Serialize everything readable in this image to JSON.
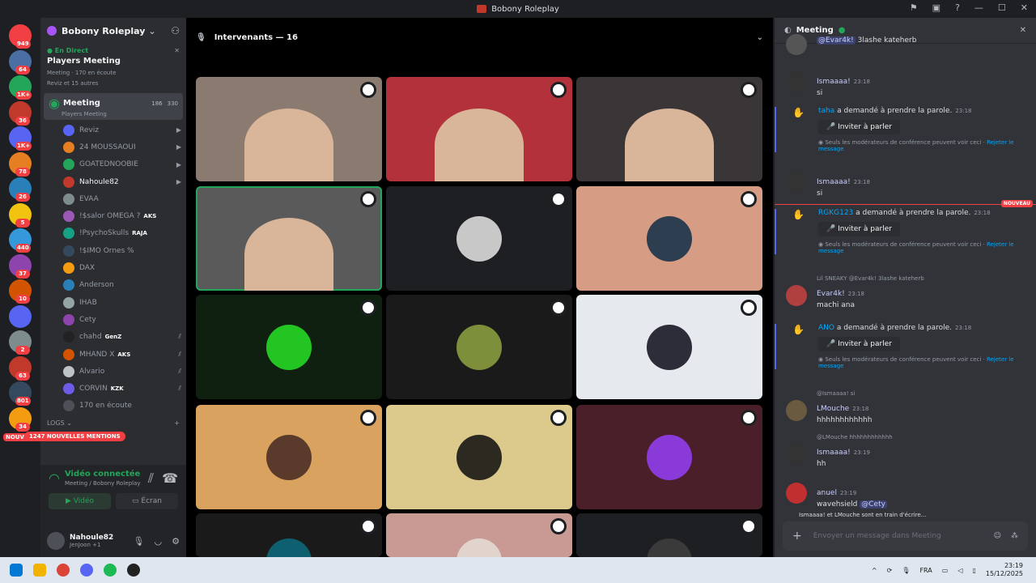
{
  "window": {
    "title": "Bobony Roleplay"
  },
  "servers": [
    {
      "badge": "949",
      "color": "#f23f43"
    },
    {
      "badge": "64",
      "color": "#4a6fa5"
    },
    {
      "badge": "1K+",
      "color": "#23a55a"
    },
    {
      "badge": "36",
      "color": "#c0392b"
    },
    {
      "badge": "1K+",
      "color": "#5865f2"
    },
    {
      "badge": "78",
      "color": "#e67e22"
    },
    {
      "badge": "26",
      "color": "#2980b9"
    },
    {
      "badge": "5",
      "color": "#f1c40f"
    },
    {
      "badge": "440",
      "color": "#3498db"
    },
    {
      "badge": "37",
      "color": "#8e44ad"
    },
    {
      "badge": "10",
      "color": "#d35400"
    },
    {
      "badge": "",
      "color": "#5865f2"
    },
    {
      "badge": "2",
      "color": "#7f8c8d"
    },
    {
      "badge": "63",
      "color": "#c0392b"
    },
    {
      "badge": "801",
      "color": "#34495e"
    },
    {
      "badge": "34",
      "color": "#f39c12"
    }
  ],
  "sidebar": {
    "guild_name": "Bobony Roleplay",
    "live_tag": "En Direct",
    "live_title": "Players Meeting",
    "live_sub": "Meeting · 170 en écoute",
    "live_sub2": "Reviz et 15 autres",
    "active_channel": {
      "name": "Meeting",
      "sub": "Players Meeting",
      "video_count": "186",
      "listeners": "330"
    },
    "members": [
      {
        "name": "Reviz",
        "tag": "",
        "icon": "camera-icon"
      },
      {
        "name": "24 MOUSSAOUI",
        "tag": "",
        "icon": "camera-icon"
      },
      {
        "name": "GOATEDNOOBIE",
        "tag": "",
        "icon": "camera-icon"
      },
      {
        "name": "Nahoule82",
        "tag": "",
        "icon": "camera-icon"
      },
      {
        "name": "EVAA",
        "tag": "",
        "icon": ""
      },
      {
        "name": "!$salor OMEGA ?",
        "tag": "AKS",
        "icon": ""
      },
      {
        "name": "!PsychoSkulls",
        "tag": "RAJA",
        "icon": ""
      },
      {
        "name": "!$IMO Ornes %",
        "tag": "",
        "icon": ""
      },
      {
        "name": "DAX",
        "tag": "",
        "icon": ""
      },
      {
        "name": "Anderson",
        "tag": "",
        "icon": ""
      },
      {
        "name": "IHAB",
        "tag": "",
        "icon": ""
      },
      {
        "name": "Cety",
        "tag": "",
        "icon": ""
      },
      {
        "name": "chahd",
        "tag": "GenZ",
        "icon": "muted-mic-icon"
      },
      {
        "name": "MHAND X",
        "tag": "AKS",
        "icon": "muted-mic-icon"
      },
      {
        "name": "Alvario",
        "tag": "",
        "icon": "muted-mic-icon"
      },
      {
        "name": "CORVIN",
        "tag": "KZK",
        "icon": "muted-mic-icon"
      },
      {
        "name": "170 en écoute",
        "tag": "",
        "icon": ""
      }
    ],
    "logs_label": "LOGS",
    "new_mentions": "1247 NOUVELLES MENTIONS",
    "nouveau": "NOUVEAU",
    "voice": {
      "status": "Vidéo connectée",
      "path": "Meeting / Bobony Roleplay",
      "video_btn": "Vidéo",
      "screen_btn": "Écran"
    },
    "user": {
      "name": "Nahoule82",
      "status": "JenJoon +1"
    }
  },
  "stage": {
    "header": "Intervenants — 16",
    "tiles": [
      {
        "bg": "#8a7a70",
        "type": "cam"
      },
      {
        "bg": "#b3313a",
        "type": "cam"
      },
      {
        "bg": "#3a3536",
        "type": "cam"
      },
      {
        "bg": "#5a5a5a",
        "type": "cam",
        "speaking": true
      },
      {
        "bg": "#1e1f22",
        "type": "avatar",
        "avatar": "#c8c8c8"
      },
      {
        "bg": "#d79c84",
        "type": "avatar",
        "avatar": "#2c3e50"
      },
      {
        "bg": "#0f1f10",
        "type": "avatar",
        "avatar": "#22c522"
      },
      {
        "bg": "#1a1a1a",
        "type": "avatar",
        "avatar": "#7d8f3a"
      },
      {
        "bg": "#e6e9ee",
        "type": "avatar",
        "avatar": "#2d2d3a"
      },
      {
        "bg": "#d9a25f",
        "type": "avatar",
        "avatar": "#5a3a2a"
      },
      {
        "bg": "#dcc98c",
        "type": "avatar",
        "avatar": "#2c2a20"
      },
      {
        "bg": "#4a1f2a",
        "type": "avatar",
        "avatar": "#8a3ad8"
      },
      {
        "bg": "#1a1a1a",
        "type": "avatar",
        "avatar": "#0e6070"
      },
      {
        "bg": "#c99a94",
        "type": "avatar",
        "avatar": "#e0d4cc"
      },
      {
        "bg": "#1e1f22",
        "type": "avatar",
        "avatar": "#3a3a3a"
      }
    ]
  },
  "chat": {
    "title": "Meeting",
    "messages": [
      {
        "type": "msg",
        "author": "",
        "time": "",
        "text_pre": "",
        "mention": "@Evar4k!",
        "text": " 3lashe kateherb",
        "avatar": "#555"
      },
      {
        "type": "msg",
        "author": "Ismaaaa!",
        "time": "23:18",
        "text_pre": "",
        "mention": "",
        "text": "si",
        "avatar": "#333"
      },
      {
        "type": "sys",
        "who": "taha",
        "action": " a demandé à prendre la parole.",
        "time": "23:18"
      },
      {
        "type": "msg",
        "author": "Ismaaaa!",
        "time": "23:18",
        "text_pre": "",
        "mention": "",
        "text": "si",
        "avatar": "#333"
      },
      {
        "type": "sys",
        "who": "RGKG123",
        "action": " a demandé à prendre la parole.",
        "time": "23:18"
      },
      {
        "type": "msg",
        "author": "Evar4k!",
        "time": "23:18",
        "reply": "Lil SNEAKY @Evar4k! 3lashe kateherb",
        "text_pre": "",
        "mention": "",
        "text": "machi ana",
        "avatar": "#b04040"
      },
      {
        "type": "sys",
        "who": "ANO",
        "action": " a demandé à prendre la parole.",
        "time": "23:18"
      },
      {
        "type": "msg",
        "author": "LMouche",
        "time": "23:18",
        "reply": "@Ismaaaa! si",
        "text_pre": "",
        "mention": "",
        "text": "hhhhhhhhhhhh",
        "avatar": "#6a5a40"
      },
      {
        "type": "msg",
        "author": "Ismaaaa!",
        "time": "23:19",
        "reply": "@LMouche hhhhhhhhhhhh",
        "text_pre": "",
        "mention": "",
        "text": "hh",
        "avatar": "#333"
      },
      {
        "type": "msg",
        "author": "anuel",
        "time": "23:19",
        "text_pre": "wavehsield ",
        "mention": "@Cety",
        "text": "",
        "avatar": "#c03030"
      }
    ],
    "invite_label": "Inviter à parler",
    "note": "Seuls les modérateurs de conférence peuvent voir ceci · ",
    "note_link": "Rejeter le message",
    "nouveau": "NOUVEAU",
    "typing": "Ismaaaa! et LMouche sont en train d'écrire...",
    "placeholder": "Envoyer un message dans Meeting"
  },
  "taskbar": {
    "lang": "FRA",
    "time": "23:19",
    "date": "15/12/2025"
  }
}
